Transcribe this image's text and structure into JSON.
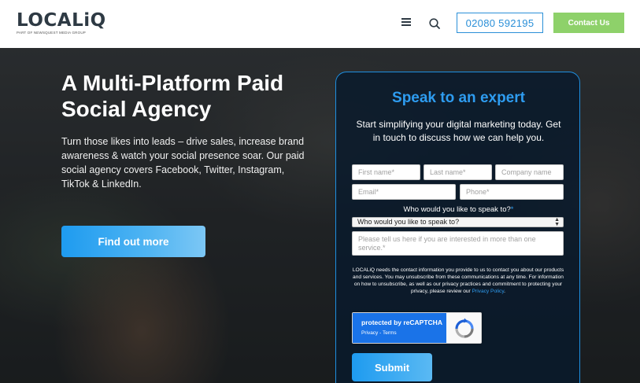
{
  "header": {
    "logo": "LOCALiQ",
    "logo_subtitle": "PART OF NEWSQUEST MEDIA GROUP",
    "menu_icon": "hamburger-icon",
    "search_icon": "search-icon",
    "phone": "02080 592195",
    "contact_label": "Contact Us"
  },
  "hero": {
    "title": "A Multi-Platform Paid Social Agency",
    "description": "Turn those likes into leads – drive sales, increase brand awareness & watch your social presence soar. Our paid social agency covers Facebook, Twitter, Instagram, TikTok & LinkedIn.",
    "cta_label": "Find out more"
  },
  "form": {
    "title": "Speak to an expert",
    "subtitle": "Start simplifying your digital marketing today. Get in touch to discuss how we can help you.",
    "first_name_placeholder": "First name*",
    "last_name_placeholder": "Last name*",
    "company_placeholder": "Company name",
    "email_placeholder": "Email*",
    "phone_placeholder": "Phone*",
    "who_label": "Who would you like to speak to?",
    "who_required": "*",
    "who_selected": "Who would you like to speak to?",
    "message_placeholder": "Please tell us here if you are interested in more than one service.*",
    "consent_text": "LOCALiQ needs the contact information you provide to us to contact you about our products and services. You may unsubscribe from these communications at any time. For information on how to unsubscribe, as well as our privacy practices and commitment to protecting your privacy, please review our",
    "privacy_link": "Privacy Policy",
    "consent_end": ".",
    "recaptcha_protected": "protected by reCAPTCHA",
    "recaptcha_links": "Privacy - Terms",
    "submit_label": "Submit"
  },
  "colors": {
    "accent_blue": "#2e9cf0",
    "contact_green": "#8ed16a",
    "logo_dark": "#2e3a44"
  }
}
